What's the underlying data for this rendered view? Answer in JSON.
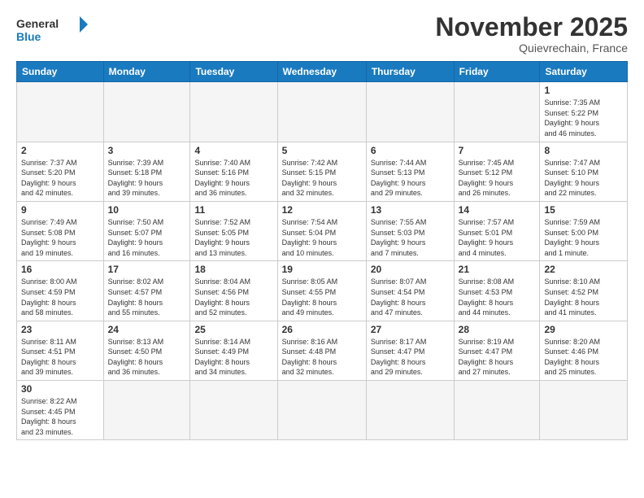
{
  "header": {
    "logo_general": "General",
    "logo_blue": "Blue",
    "month_title": "November 2025",
    "location": "Quievrechain, France"
  },
  "days_of_week": [
    "Sunday",
    "Monday",
    "Tuesday",
    "Wednesday",
    "Thursday",
    "Friday",
    "Saturday"
  ],
  "weeks": [
    [
      {
        "day": "",
        "info": "",
        "empty": true
      },
      {
        "day": "",
        "info": "",
        "empty": true
      },
      {
        "day": "",
        "info": "",
        "empty": true
      },
      {
        "day": "",
        "info": "",
        "empty": true
      },
      {
        "day": "",
        "info": "",
        "empty": true
      },
      {
        "day": "",
        "info": "",
        "empty": true
      },
      {
        "day": "1",
        "info": "Sunrise: 7:35 AM\nSunset: 5:22 PM\nDaylight: 9 hours\nand 46 minutes."
      }
    ],
    [
      {
        "day": "2",
        "info": "Sunrise: 7:37 AM\nSunset: 5:20 PM\nDaylight: 9 hours\nand 42 minutes."
      },
      {
        "day": "3",
        "info": "Sunrise: 7:39 AM\nSunset: 5:18 PM\nDaylight: 9 hours\nand 39 minutes."
      },
      {
        "day": "4",
        "info": "Sunrise: 7:40 AM\nSunset: 5:16 PM\nDaylight: 9 hours\nand 36 minutes."
      },
      {
        "day": "5",
        "info": "Sunrise: 7:42 AM\nSunset: 5:15 PM\nDaylight: 9 hours\nand 32 minutes."
      },
      {
        "day": "6",
        "info": "Sunrise: 7:44 AM\nSunset: 5:13 PM\nDaylight: 9 hours\nand 29 minutes."
      },
      {
        "day": "7",
        "info": "Sunrise: 7:45 AM\nSunset: 5:12 PM\nDaylight: 9 hours\nand 26 minutes."
      },
      {
        "day": "8",
        "info": "Sunrise: 7:47 AM\nSunset: 5:10 PM\nDaylight: 9 hours\nand 22 minutes."
      }
    ],
    [
      {
        "day": "9",
        "info": "Sunrise: 7:49 AM\nSunset: 5:08 PM\nDaylight: 9 hours\nand 19 minutes."
      },
      {
        "day": "10",
        "info": "Sunrise: 7:50 AM\nSunset: 5:07 PM\nDaylight: 9 hours\nand 16 minutes."
      },
      {
        "day": "11",
        "info": "Sunrise: 7:52 AM\nSunset: 5:05 PM\nDaylight: 9 hours\nand 13 minutes."
      },
      {
        "day": "12",
        "info": "Sunrise: 7:54 AM\nSunset: 5:04 PM\nDaylight: 9 hours\nand 10 minutes."
      },
      {
        "day": "13",
        "info": "Sunrise: 7:55 AM\nSunset: 5:03 PM\nDaylight: 9 hours\nand 7 minutes."
      },
      {
        "day": "14",
        "info": "Sunrise: 7:57 AM\nSunset: 5:01 PM\nDaylight: 9 hours\nand 4 minutes."
      },
      {
        "day": "15",
        "info": "Sunrise: 7:59 AM\nSunset: 5:00 PM\nDaylight: 9 hours\nand 1 minute."
      }
    ],
    [
      {
        "day": "16",
        "info": "Sunrise: 8:00 AM\nSunset: 4:59 PM\nDaylight: 8 hours\nand 58 minutes."
      },
      {
        "day": "17",
        "info": "Sunrise: 8:02 AM\nSunset: 4:57 PM\nDaylight: 8 hours\nand 55 minutes."
      },
      {
        "day": "18",
        "info": "Sunrise: 8:04 AM\nSunset: 4:56 PM\nDaylight: 8 hours\nand 52 minutes."
      },
      {
        "day": "19",
        "info": "Sunrise: 8:05 AM\nSunset: 4:55 PM\nDaylight: 8 hours\nand 49 minutes."
      },
      {
        "day": "20",
        "info": "Sunrise: 8:07 AM\nSunset: 4:54 PM\nDaylight: 8 hours\nand 47 minutes."
      },
      {
        "day": "21",
        "info": "Sunrise: 8:08 AM\nSunset: 4:53 PM\nDaylight: 8 hours\nand 44 minutes."
      },
      {
        "day": "22",
        "info": "Sunrise: 8:10 AM\nSunset: 4:52 PM\nDaylight: 8 hours\nand 41 minutes."
      }
    ],
    [
      {
        "day": "23",
        "info": "Sunrise: 8:11 AM\nSunset: 4:51 PM\nDaylight: 8 hours\nand 39 minutes."
      },
      {
        "day": "24",
        "info": "Sunrise: 8:13 AM\nSunset: 4:50 PM\nDaylight: 8 hours\nand 36 minutes."
      },
      {
        "day": "25",
        "info": "Sunrise: 8:14 AM\nSunset: 4:49 PM\nDaylight: 8 hours\nand 34 minutes."
      },
      {
        "day": "26",
        "info": "Sunrise: 8:16 AM\nSunset: 4:48 PM\nDaylight: 8 hours\nand 32 minutes."
      },
      {
        "day": "27",
        "info": "Sunrise: 8:17 AM\nSunset: 4:47 PM\nDaylight: 8 hours\nand 29 minutes."
      },
      {
        "day": "28",
        "info": "Sunrise: 8:19 AM\nSunset: 4:47 PM\nDaylight: 8 hours\nand 27 minutes."
      },
      {
        "day": "29",
        "info": "Sunrise: 8:20 AM\nSunset: 4:46 PM\nDaylight: 8 hours\nand 25 minutes."
      }
    ],
    [
      {
        "day": "30",
        "info": "Sunrise: 8:22 AM\nSunset: 4:45 PM\nDaylight: 8 hours\nand 23 minutes."
      },
      {
        "day": "",
        "info": "",
        "empty": true
      },
      {
        "day": "",
        "info": "",
        "empty": true
      },
      {
        "day": "",
        "info": "",
        "empty": true
      },
      {
        "day": "",
        "info": "",
        "empty": true
      },
      {
        "day": "",
        "info": "",
        "empty": true
      },
      {
        "day": "",
        "info": "",
        "empty": true
      }
    ]
  ]
}
